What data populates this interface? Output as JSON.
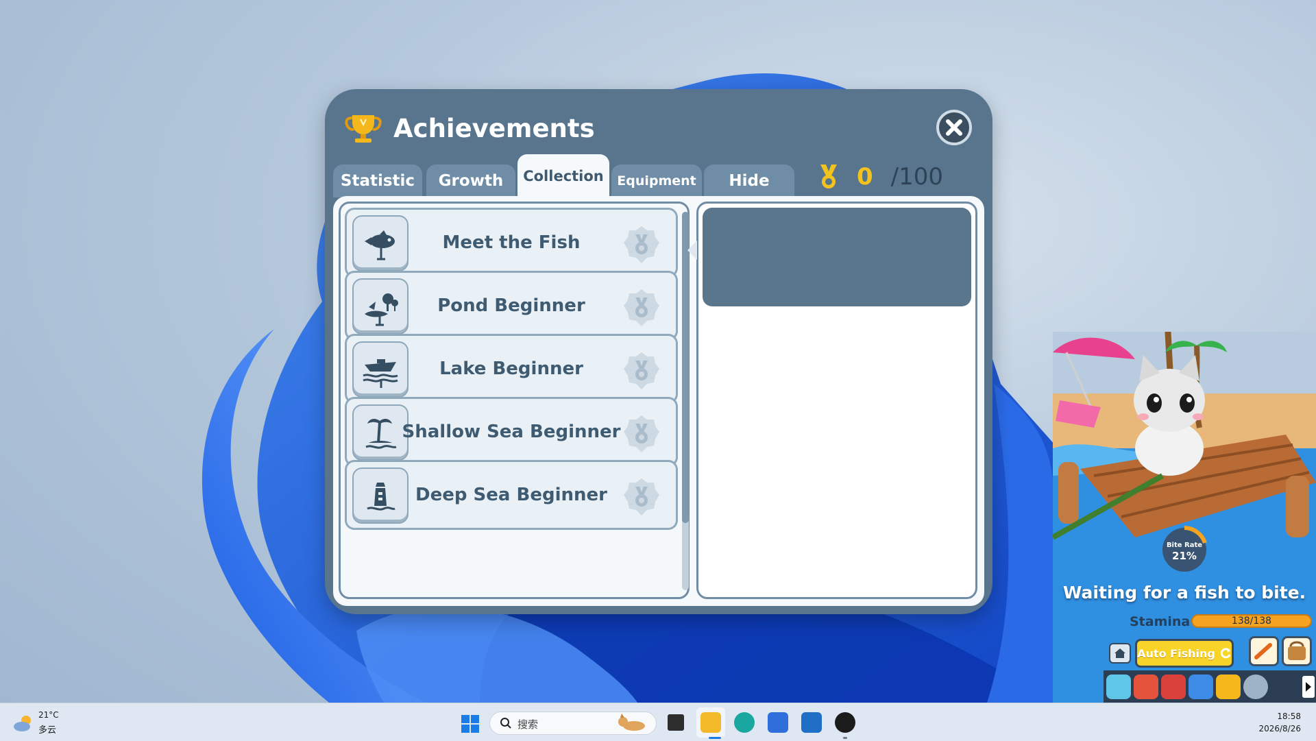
{
  "achievements": {
    "title": "Achievements",
    "tabs": [
      {
        "label": "Statistic",
        "active": false
      },
      {
        "label": "Growth",
        "active": false
      },
      {
        "label": "Collection",
        "active": true
      },
      {
        "label": "Equipment",
        "active": false
      },
      {
        "label": "Hide",
        "active": false
      }
    ],
    "medal_count": "0",
    "medal_total": "/100",
    "items": [
      {
        "label": "Meet the Fish",
        "icon": "fish-icon"
      },
      {
        "label": "Pond Beginner",
        "icon": "pond-icon"
      },
      {
        "label": "Lake Beginner",
        "icon": "boat-icon"
      },
      {
        "label": "Shallow Sea Beginner",
        "icon": "palm-island-icon"
      },
      {
        "label": "Deep Sea Beginner",
        "icon": "lighthouse-icon"
      }
    ]
  },
  "game": {
    "bite_rate_label": "Bite Rate",
    "bite_rate_value": "21%",
    "status": "Waiting for a fish to bite.",
    "stamina_label": "Stamina",
    "stamina_value": "138/138",
    "auto_fishing_label": "Auto Fishing"
  },
  "taskbar": {
    "weather_temp": "21°C",
    "weather_condition": "多云",
    "search_placeholder": "搜索",
    "time": "18:58",
    "date": "2026/8/26"
  },
  "colors": {
    "window_bg": "#58758d",
    "tab_bg": "#6f8da6",
    "accent_gold": "#f3c31d",
    "auto_fishing": "#f7d427",
    "stamina": "#f5a321"
  }
}
